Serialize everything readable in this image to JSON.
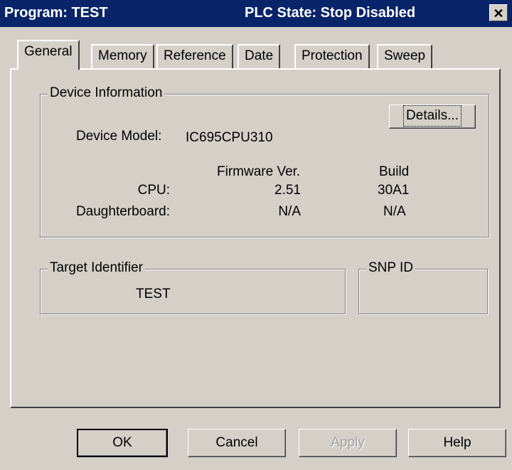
{
  "window": {
    "program_title": "Program: TEST",
    "plc_state": "PLC State: Stop Disabled",
    "close_glyph": "✕"
  },
  "tabs": [
    {
      "label": "General",
      "active": true
    },
    {
      "label": "Memory"
    },
    {
      "label": "Reference"
    },
    {
      "label": "Date"
    },
    {
      "label": "Protection"
    },
    {
      "label": "Sweep"
    }
  ],
  "device_info": {
    "legend": "Device Information",
    "details_button": "Details...",
    "model_label": "Device Model:",
    "model_value": "IC695CPU310",
    "col_firmware": "Firmware Ver.",
    "col_build": "Build",
    "rows": [
      {
        "label": "CPU:",
        "firmware": "2.51",
        "build": "30A1"
      },
      {
        "label": "Daughterboard:",
        "firmware": "N/A",
        "build": "N/A"
      }
    ]
  },
  "target": {
    "legend": "Target Identifier",
    "value": "TEST"
  },
  "snp": {
    "legend": "SNP ID",
    "value": ""
  },
  "buttons": {
    "ok": "OK",
    "cancel": "Cancel",
    "apply": "Apply",
    "help": "Help"
  }
}
